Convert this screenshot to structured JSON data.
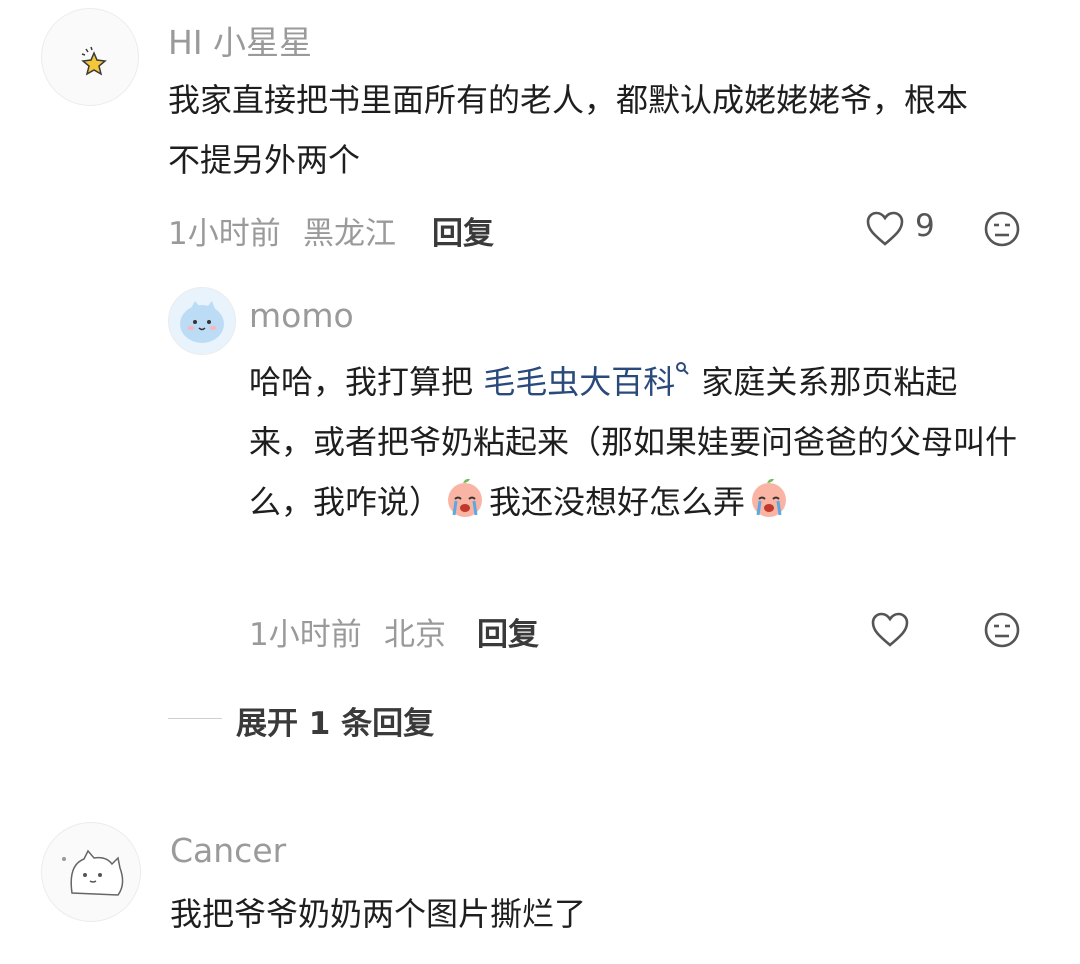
{
  "comments": [
    {
      "username": "HI 小星星",
      "content": "我家直接把书里面所有的老人，都默认成姥姥姥爷，根本不提另外两个",
      "time": "1小时前",
      "location": "黑龙江",
      "reply_label": "回复",
      "likes": "9",
      "avatar_icon": "star-icon"
    },
    {
      "username": "momo",
      "content_parts": {
        "prefix": "哈哈，我打算把 ",
        "link": "毛毛虫大百科",
        "body": " 家庭关系那页粘起来，或者把爷奶粘起来（那如果娃要问爸爸的父母叫什么，我咋说）",
        "after_emoji": "我还没想好怎么弄"
      },
      "time": "1小时前",
      "location": "北京",
      "reply_label": "回复",
      "avatar_icon": "blue-cat-icon",
      "emoji_icon": "crying-peach-emoji"
    },
    {
      "username": "Cancer",
      "content": "我把爷爷奶奶两个图片撕烂了",
      "avatar_icon": "sketch-cat-icon"
    }
  ],
  "expand_replies": "展开 1 条回复",
  "colors": {
    "link": "#2b4a7c",
    "meta": "#9a9a9a"
  }
}
